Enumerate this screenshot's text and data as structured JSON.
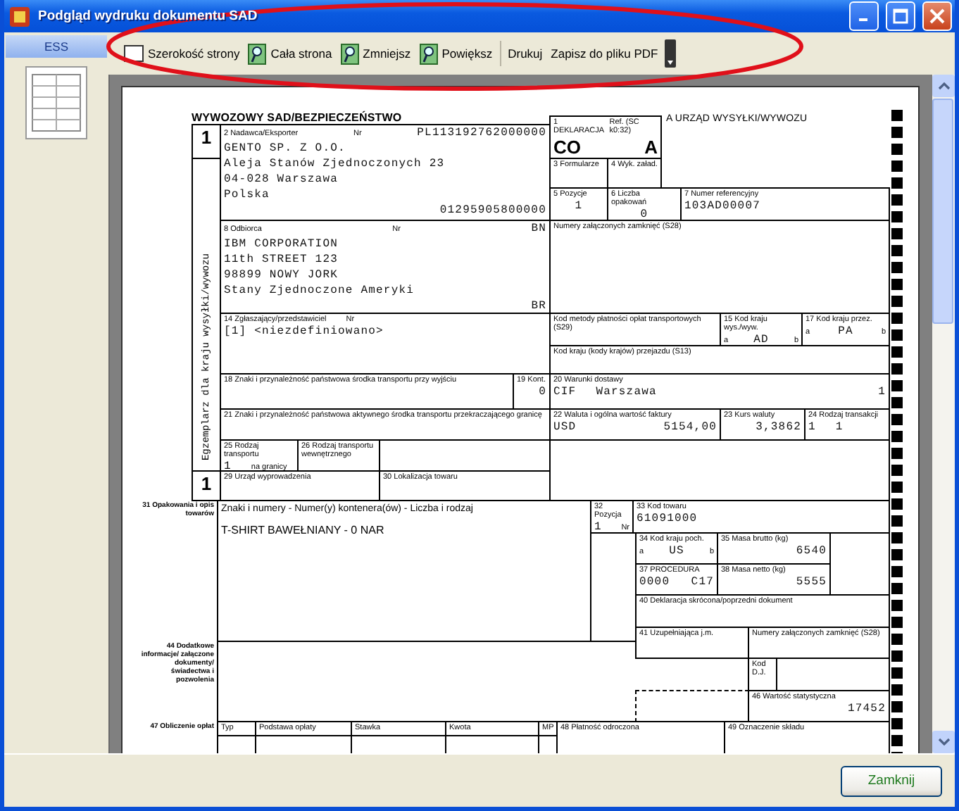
{
  "window": {
    "title": "Podgląd wydruku dokumentu SAD"
  },
  "sidebar": {
    "tab": "ESS"
  },
  "toolbar": {
    "buttons": [
      {
        "label": "Szerokość strony"
      },
      {
        "label": "Cała strona"
      },
      {
        "label": "Zmniejsz"
      },
      {
        "label": "Powiększ"
      },
      {
        "label": "Drukuj"
      },
      {
        "label": "Zapisz do pliku PDF"
      }
    ]
  },
  "form": {
    "cells": [
      {
        "items": [
          {
            "kind": "heading",
            "text": "WYWOZOWY SAD/BEZPIECZEŃSTWO"
          }
        ]
      },
      {
        "items": [
          {
            "kind": "heading_light",
            "text": "A URZĄD WYSYŁKI/WYWOZU"
          }
        ]
      },
      {
        "items": [
          {
            "kind": "big",
            "text": "1"
          }
        ]
      },
      {
        "items": [
          {
            "kind": "vertical",
            "text": "Egzemplarz dla kraju wysyłki/wywozu"
          }
        ]
      },
      {
        "items": [
          {
            "kind": "row",
            "parts": [
              {
                "kind": "label",
                "text": "2 Nadawca/Eksporter"
              },
              {
                "kind": "label",
                "text": "Nr"
              },
              {
                "kind": "value",
                "text": "PL113192762000000"
              }
            ]
          },
          {
            "kind": "value",
            "text": "GENTO SP. Z O.O."
          },
          {
            "kind": "value",
            "text": "Aleja Stanów Zjednoczonych 23"
          },
          {
            "kind": "value",
            "text": "04-028 Warszawa"
          },
          {
            "kind": "value",
            "text": "Polska"
          },
          {
            "kind": "value_right",
            "text": "01295905800000"
          }
        ]
      },
      {
        "items": [
          {
            "kind": "row",
            "parts": [
              {
                "kind": "label",
                "text": "1 DEKLARACJA"
              },
              {
                "kind": "label",
                "text": "Ref. (SC k0:32)"
              }
            ]
          },
          {
            "kind": "row",
            "parts": [
              {
                "kind": "big",
                "text": "CO"
              },
              {
                "kind": "big",
                "text": "A"
              }
            ]
          }
        ]
      },
      {
        "items": [
          {
            "kind": "label",
            "text": "3 Formularze"
          }
        ]
      },
      {
        "items": [
          {
            "kind": "label",
            "text": "4 Wyk. załad."
          }
        ]
      },
      {
        "items": [
          {
            "kind": "label",
            "text": "5 Pozycje"
          },
          {
            "kind": "value_center",
            "text": "1"
          }
        ]
      },
      {
        "items": [
          {
            "kind": "label",
            "text": "6 Liczba opakowań"
          },
          {
            "kind": "value_center",
            "text": "0"
          }
        ]
      },
      {
        "items": [
          {
            "kind": "label",
            "text": "7 Numer referencyjny"
          },
          {
            "kind": "value",
            "text": "103AD00007"
          }
        ]
      },
      {
        "items": [
          {
            "kind": "row",
            "parts": [
              {
                "kind": "label",
                "text": "8 Odbiorca"
              },
              {
                "kind": "label",
                "text": "Nr"
              },
              {
                "kind": "value",
                "text": "BN"
              }
            ]
          },
          {
            "kind": "value",
            "text": "IBM CORPORATION"
          },
          {
            "kind": "value",
            "text": "11th STREET 123"
          },
          {
            "kind": "value",
            "text": "98899 NOWY JORK"
          },
          {
            "kind": "value",
            "text": "Stany Zjednoczone Ameryki"
          },
          {
            "kind": "value_right",
            "text": "BR"
          }
        ]
      },
      {
        "items": [
          {
            "kind": "label",
            "text": "Numery załączonych zamknięć (S28)"
          }
        ]
      },
      {
        "items": [
          {
            "kind": "row_left",
            "parts": [
              {
                "kind": "label",
                "text": "14 Zgłaszający/przedstawiciel"
              },
              {
                "kind": "label",
                "text": "Nr"
              }
            ]
          },
          {
            "kind": "value",
            "text": "[1] <niezdefiniowano>"
          }
        ]
      },
      {
        "items": [
          {
            "kind": "label",
            "text": "Kod metody płatności opłat transportowych (S29)"
          }
        ]
      },
      {
        "items": [
          {
            "kind": "label",
            "text": "15 Kod kraju wys./wyw."
          },
          {
            "kind": "row",
            "parts": [
              {
                "kind": "label",
                "text": "a"
              },
              {
                "kind": "value",
                "text": "AD"
              },
              {
                "kind": "label",
                "text": "b"
              }
            ]
          }
        ]
      },
      {
        "items": [
          {
            "kind": "label",
            "text": "17 Kod kraju przez."
          },
          {
            "kind": "row",
            "parts": [
              {
                "kind": "label",
                "text": "a"
              },
              {
                "kind": "value",
                "text": "PA"
              },
              {
                "kind": "label",
                "text": "b"
              }
            ]
          }
        ]
      },
      {
        "items": [
          {
            "kind": "label",
            "text": "Kod kraju (kody krajów) przejazdu (S13)"
          }
        ]
      },
      {
        "items": [
          {
            "kind": "label",
            "text": "18 Znaki i przynależność państwowa środka transportu przy wyjściu"
          }
        ]
      },
      {
        "items": [
          {
            "kind": "label",
            "text": "19 Kont."
          },
          {
            "kind": "value_right",
            "text": "0"
          }
        ]
      },
      {
        "items": [
          {
            "kind": "label",
            "text": "20 Warunki dostawy"
          },
          {
            "kind": "row",
            "parts": [
              {
                "kind": "row_left",
                "parts": [
                  {
                    "kind": "value",
                    "text": "CIF"
                  },
                  {
                    "kind": "value",
                    "text": "Warszawa"
                  }
                ]
              },
              {
                "kind": "value",
                "text": "1"
              }
            ]
          }
        ]
      },
      {
        "items": [
          {
            "kind": "label",
            "text": "21 Znaki i przynależność państwowa aktywnego środka transportu przekraczającego granicę"
          }
        ]
      },
      {
        "items": [
          {
            "kind": "label",
            "text": "22 Waluta i ogólna wartość faktury"
          },
          {
            "kind": "row",
            "parts": [
              {
                "kind": "value",
                "text": "USD"
              },
              {
                "kind": "value",
                "text": "5154,00"
              }
            ]
          }
        ]
      },
      {
        "items": [
          {
            "kind": "label",
            "text": "23 Kurs waluty"
          },
          {
            "kind": "value_right",
            "text": "3,3862"
          }
        ]
      },
      {
        "items": [
          {
            "kind": "label",
            "text": "24 Rodzaj transakcji"
          },
          {
            "kind": "row_left",
            "parts": [
              {
                "kind": "value",
                "text": "1"
              },
              {
                "kind": "value",
                "text": "1"
              }
            ]
          }
        ]
      },
      {
        "items": [
          {
            "kind": "label",
            "text": "25 Rodzaj transportu"
          },
          {
            "kind": "row_left",
            "parts": [
              {
                "kind": "value",
                "text": "1"
              },
              {
                "kind": "label",
                "text": "na granicy"
              }
            ]
          }
        ]
      },
      {
        "items": [
          {
            "kind": "label",
            "text": "26 Rodzaj transportu wewnętrznego"
          }
        ]
      },
      {
        "items": [
          {
            "kind": "big",
            "text": "1"
          }
        ]
      },
      {
        "items": [
          {
            "kind": "label",
            "text": "29 Urząd wyprowadzenia"
          }
        ]
      },
      {
        "items": [
          {
            "kind": "label",
            "text": "30 Lokalizacja towaru"
          }
        ]
      },
      {
        "items": [
          {
            "kind": "side",
            "text": "31 Opakowania i opis towarów"
          }
        ]
      },
      {
        "items": [
          {
            "kind": "label_large",
            "text": "Znaki i numery - Numer(y) kontenera(ów) - Liczba i rodzaj"
          },
          {
            "kind": "text",
            "text": "T-SHIRT BAWEŁNIANY - 0 NAR"
          }
        ]
      },
      {
        "items": [
          {
            "kind": "label",
            "text": "32 Pozycja"
          },
          {
            "kind": "row",
            "parts": [
              {
                "kind": "value",
                "text": "1"
              },
              {
                "kind": "label",
                "text": "Nr"
              }
            ]
          }
        ]
      },
      {
        "items": [
          {
            "kind": "label",
            "text": "33 Kod towaru"
          },
          {
            "kind": "value",
            "text": "61091000"
          }
        ]
      },
      {
        "items": [
          {
            "kind": "label",
            "text": "34 Kod kraju poch."
          },
          {
            "kind": "row",
            "parts": [
              {
                "kind": "label",
                "text": "a"
              },
              {
                "kind": "value",
                "text": "US"
              },
              {
                "kind": "label",
                "text": "b"
              }
            ]
          }
        ]
      },
      {
        "items": [
          {
            "kind": "label",
            "text": "35 Masa brutto (kg)"
          },
          {
            "kind": "value_right",
            "text": "6540"
          }
        ]
      },
      {
        "items": [
          {
            "kind": "label",
            "text": "37 PROCEDURA"
          },
          {
            "kind": "row",
            "parts": [
              {
                "kind": "value",
                "text": "0000"
              },
              {
                "kind": "value",
                "text": "C17"
              }
            ]
          }
        ]
      },
      {
        "items": [
          {
            "kind": "label",
            "text": "38 Masa netto (kg)"
          },
          {
            "kind": "value_right",
            "text": "5555"
          }
        ]
      },
      {
        "items": [
          {
            "kind": "label",
            "text": "40 Deklaracja skrócona/poprzedni dokument"
          }
        ]
      },
      {
        "items": [
          {
            "kind": "label",
            "text": "41 Uzupełniająca j.m."
          }
        ]
      },
      {
        "items": [
          {
            "kind": "label",
            "text": "Numery załączonych zamknięć (S28)"
          }
        ]
      },
      {
        "items": [
          {
            "kind": "side",
            "text": "44 Dodatkowe informacje/ załączone dokumenty/ świadectwa i pozwolenia"
          }
        ]
      },
      {
        "items": [
          {
            "kind": "label",
            "text": "Kod D.J."
          }
        ]
      },
      {
        "items": [
          {
            "kind": "label",
            "text": "46 Wartość statystyczna"
          },
          {
            "kind": "value_right",
            "text": "17452"
          }
        ]
      },
      {
        "items": [
          {
            "kind": "side",
            "text": "47 Obliczenie opłat"
          }
        ]
      },
      {
        "items": [
          {
            "kind": "label",
            "text": "Typ"
          }
        ]
      },
      {
        "items": [
          {
            "kind": "label",
            "text": "Podstawa opłaty"
          }
        ]
      },
      {
        "items": [
          {
            "kind": "label",
            "text": "Stawka"
          }
        ]
      },
      {
        "items": [
          {
            "kind": "label",
            "text": "Kwota"
          }
        ]
      },
      {
        "items": [
          {
            "kind": "label",
            "text": "MP"
          }
        ]
      },
      {
        "items": [
          {
            "kind": "label",
            "text": "48 Płatność odroczona"
          }
        ]
      },
      {
        "items": [
          {
            "kind": "label",
            "text": "49 Oznaczenie składu"
          }
        ]
      }
    ]
  },
  "footer": {
    "close_button": "Zamknij"
  }
}
